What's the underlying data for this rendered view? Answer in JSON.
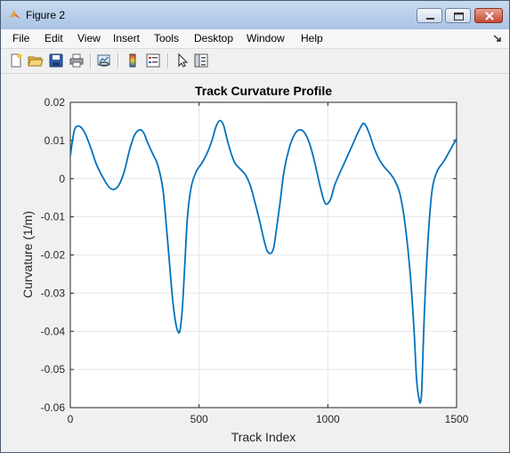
{
  "window": {
    "title": "Figure 2"
  },
  "menu": {
    "items": [
      "File",
      "Edit",
      "View",
      "Insert",
      "Tools",
      "Desktop",
      "Window",
      "Help"
    ]
  },
  "toolbar": {
    "icons": [
      "new-figure-icon",
      "open-file-icon",
      "save-icon",
      "print-icon",
      "link-plot-icon",
      "colorbar-icon",
      "legend-icon",
      "pointer-icon",
      "property-inspector-icon"
    ]
  },
  "colors": {
    "line": "#0072bd",
    "accent_close": "#c44a34"
  },
  "chart_data": {
    "type": "line",
    "title": "Track Curvature Profile",
    "xlabel": "Track Index",
    "ylabel": "Curvature (1/m)",
    "xlim": [
      0,
      1500
    ],
    "ylim": [
      -0.06,
      0.02
    ],
    "xticks": [
      0,
      500,
      1000,
      1500
    ],
    "xtick_labels": [
      "0",
      "500",
      "1000",
      "1500"
    ],
    "yticks": [
      0.02,
      0.01,
      0,
      -0.01,
      -0.02,
      -0.03,
      -0.04,
      -0.05,
      -0.06
    ],
    "ytick_labels": [
      "0.02",
      "0.01",
      "0",
      "-0.01",
      "-0.02",
      "-0.03",
      "-0.04",
      "-0.05",
      "-0.06"
    ],
    "grid": true,
    "series": [
      {
        "x": [
          0,
          15,
          30,
          45,
          60,
          80,
          100,
          125,
          150,
          170,
          190,
          210,
          230,
          250,
          270,
          285,
          300,
          320,
          340,
          360,
          375,
          385,
          395,
          405,
          415,
          425,
          435,
          445,
          455,
          470,
          490,
          510,
          530,
          550,
          565,
          580,
          595,
          610,
          625,
          640,
          660,
          680,
          700,
          720,
          735,
          750,
          765,
          780,
          790,
          800,
          815,
          830,
          850,
          870,
          890,
          910,
          930,
          950,
          970,
          990,
          1010,
          1025,
          1040,
          1060,
          1080,
          1100,
          1120,
          1140,
          1160,
          1180,
          1200,
          1220,
          1240,
          1260,
          1280,
          1300,
          1320,
          1335,
          1345,
          1355,
          1360,
          1365,
          1375,
          1390,
          1405,
          1425,
          1450,
          1475,
          1500
        ],
        "y": [
          0.006,
          0.0125,
          0.0138,
          0.0132,
          0.0115,
          0.008,
          0.004,
          0.0005,
          -0.0022,
          -0.0028,
          -0.0015,
          0.002,
          0.0075,
          0.0115,
          0.0128,
          0.012,
          0.0095,
          0.0065,
          0.0035,
          -0.003,
          -0.014,
          -0.022,
          -0.03,
          -0.036,
          -0.0395,
          -0.04,
          -0.034,
          -0.022,
          -0.01,
          -0.002,
          0.002,
          0.004,
          0.0065,
          0.01,
          0.0135,
          0.0152,
          0.014,
          0.01,
          0.0065,
          0.004,
          0.0025,
          0.001,
          -0.002,
          -0.007,
          -0.011,
          -0.0155,
          -0.019,
          -0.0195,
          -0.018,
          -0.0135,
          -0.006,
          0.002,
          0.008,
          0.0115,
          0.0128,
          0.012,
          0.009,
          0.004,
          -0.002,
          -0.0065,
          -0.0055,
          -0.002,
          0.0005,
          0.0035,
          0.0065,
          0.0095,
          0.0125,
          0.0145,
          0.012,
          0.008,
          0.005,
          0.003,
          0.0015,
          -0.0005,
          -0.004,
          -0.012,
          -0.025,
          -0.04,
          -0.053,
          -0.058,
          -0.0585,
          -0.055,
          -0.035,
          -0.015,
          -0.003,
          0.002,
          0.0045,
          0.0075,
          0.0105
        ]
      }
    ]
  }
}
